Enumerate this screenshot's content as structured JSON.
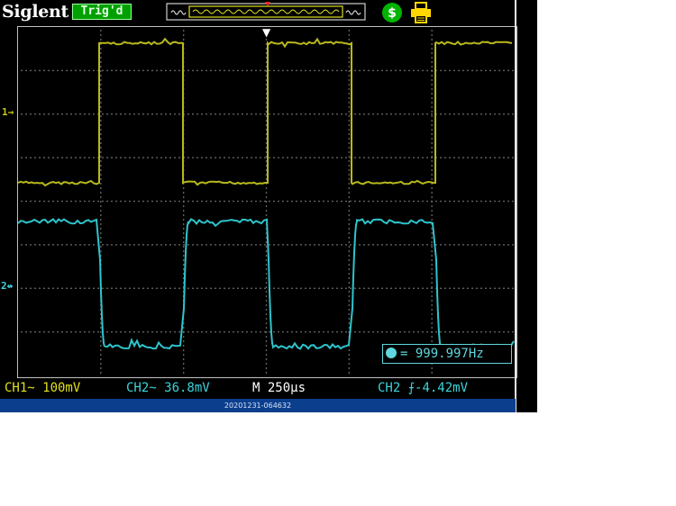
{
  "header": {
    "brand": "Siglent",
    "trigger_status": "Trig'd",
    "coupling_icon": "dollar-coin-icon",
    "print_icon": "printer-icon"
  },
  "markers": {
    "ch1": "1",
    "ch2": "2",
    "trigger_position": "▼"
  },
  "measurement": {
    "icon": "frequency-icon",
    "frequency_readout": "= 999.997Hz"
  },
  "status_bar": {
    "ch1_scale": "CH1~ 100mV",
    "ch2_scale": "CH2~ 36.8mV",
    "timebase": "M 250µs",
    "trigger_level": "CH2 ⨍-4.42mV"
  },
  "footer": {
    "timestamp": "20201231-064632"
  },
  "colors": {
    "ch1": "#b8b81c",
    "ch2": "#2fc4cc",
    "grid": "#7a7a7a",
    "trig_status": "#00a000",
    "footer": "#0b3f8e"
  }
}
